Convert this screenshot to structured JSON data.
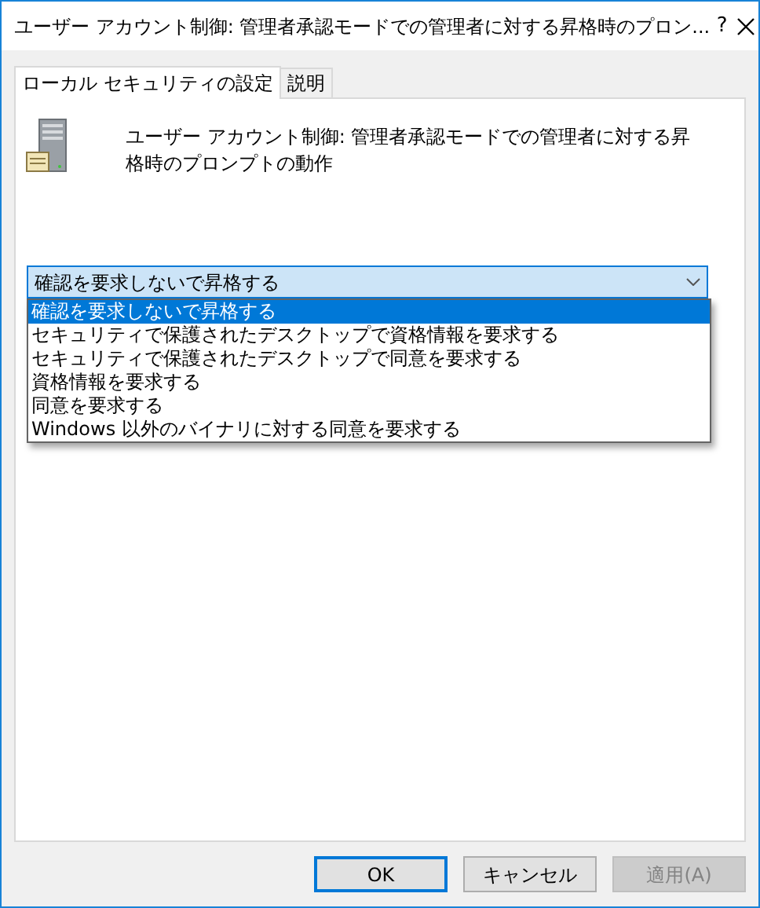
{
  "window": {
    "title": "ユーザー アカウント制御: 管理者承認モードでの管理者に対する昇格時のプロン...",
    "help": "?"
  },
  "tabs": [
    {
      "label": "ローカル セキュリティの設定",
      "selected": true
    },
    {
      "label": "説明",
      "selected": false
    }
  ],
  "policy": {
    "description": "ユーザー アカウント制御: 管理者承認モードでの管理者に対する昇格時のプロンプトの動作"
  },
  "dropdown": {
    "value": "確認を要求しないで昇格する",
    "expanded": true,
    "options": [
      {
        "label": "確認を要求しないで昇格する",
        "selected": true
      },
      {
        "label": "セキュリティで保護されたデスクトップで資格情報を要求する",
        "selected": false
      },
      {
        "label": "セキュリティで保護されたデスクトップで同意を要求する",
        "selected": false
      },
      {
        "label": "資格情報を要求する",
        "selected": false
      },
      {
        "label": "同意を要求する",
        "selected": false
      },
      {
        "label": "Windows 以外のバイナリに対する同意を要求する",
        "selected": false
      }
    ]
  },
  "buttons": [
    {
      "label": "OK",
      "default": true,
      "disabled": false
    },
    {
      "label": "キャンセル",
      "default": false,
      "disabled": false
    },
    {
      "label": "適用(A)",
      "default": false,
      "disabled": true
    }
  ]
}
